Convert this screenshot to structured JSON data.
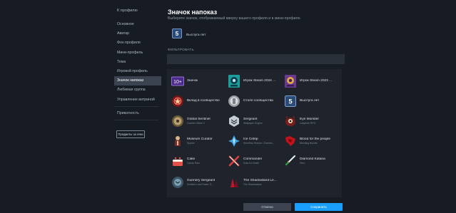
{
  "sidebar": {
    "back": "К профилю",
    "items": [
      {
        "label": "Основное"
      },
      {
        "label": "Аватар"
      },
      {
        "label": "Фон профиля"
      },
      {
        "label": "Мини-профиль"
      },
      {
        "label": "Тема"
      },
      {
        "label": "Игровой профиль"
      },
      {
        "label": "Значок напоказ"
      },
      {
        "label": "Любимая группа"
      },
      {
        "label": "Управление витриной"
      },
      {
        "label": "Приватность"
      }
    ],
    "active_index": 6,
    "showcase_button": "Предметы за очки"
  },
  "header": {
    "title": "Значок напоказ",
    "subtitle": "Выберите значок, отображаемый вверху вашего профиля и в мини-профиле."
  },
  "current_badge": {
    "label": "Выслуга лет",
    "icon": "years-of-service-5-icon"
  },
  "filter": {
    "label": "ФИЛЬТРОВАТЬ",
    "value": "",
    "placeholder": ""
  },
  "badges": [
    {
      "name": "Значок",
      "desc": "",
      "icon": "level-10-plus-icon"
    },
    {
      "name": "Игрок Steam 2024 ...",
      "desc": "",
      "icon": "steam-replay-2024-icon"
    },
    {
      "name": "Игрок Steam 2023 ...",
      "desc": "",
      "icon": "steam-replay-2023-icon"
    },
    {
      "name": "Вклад в сообщество",
      "desc": "",
      "icon": "community-contributor-icon"
    },
    {
      "name": "Столп сообщества",
      "desc": "",
      "icon": "pillar-of-community-icon"
    },
    {
      "name": "Выслуга лет",
      "desc": "",
      "icon": "years-of-service-icon"
    },
    {
      "name": "Global Sentinel",
      "desc": "Counter-Strike 2",
      "icon": "global-sentinel-icon"
    },
    {
      "name": "Sergeant",
      "desc": "Wallpaper Engine",
      "icon": "sergeant-icon"
    },
    {
      "name": "Eye Monster",
      "desc": "Labyrinth RPG",
      "icon": "eye-monster-icon"
    },
    {
      "name": "Museum Curator",
      "desc": "Spacer",
      "icon": "museum-curator-icon"
    },
    {
      "name": "Ice Cetep",
      "desc": "Sternflow Runner: Chemist...",
      "icon": "ice-crystal-icon"
    },
    {
      "name": "Blood for the people",
      "desc": "Bleeding Bundle",
      "icon": "blood-icon"
    },
    {
      "name": "Cake",
      "desc": "Candy Rain",
      "icon": "cake-icon"
    },
    {
      "name": "Commander",
      "desc": "Dota for Death",
      "icon": "commander-icon"
    },
    {
      "name": "Diamond Katana",
      "desc": "Hero",
      "icon": "diamond-katana-icon"
    },
    {
      "name": "Gunnery Sergeant",
      "desc": "Soldiers Lost Power: S...",
      "icon": "gunnery-sergeant-icon"
    },
    {
      "name": "The Shadowland Le...",
      "desc": "The Shadowland",
      "icon": "shadowland-icon"
    }
  ],
  "footer": {
    "cancel": "Отмена",
    "save": "Сохранить"
  },
  "colors": {
    "bg": "#171c24",
    "panel": "#1f232b",
    "accent": "#1a9fff",
    "active_nav": "#3c4350"
  }
}
